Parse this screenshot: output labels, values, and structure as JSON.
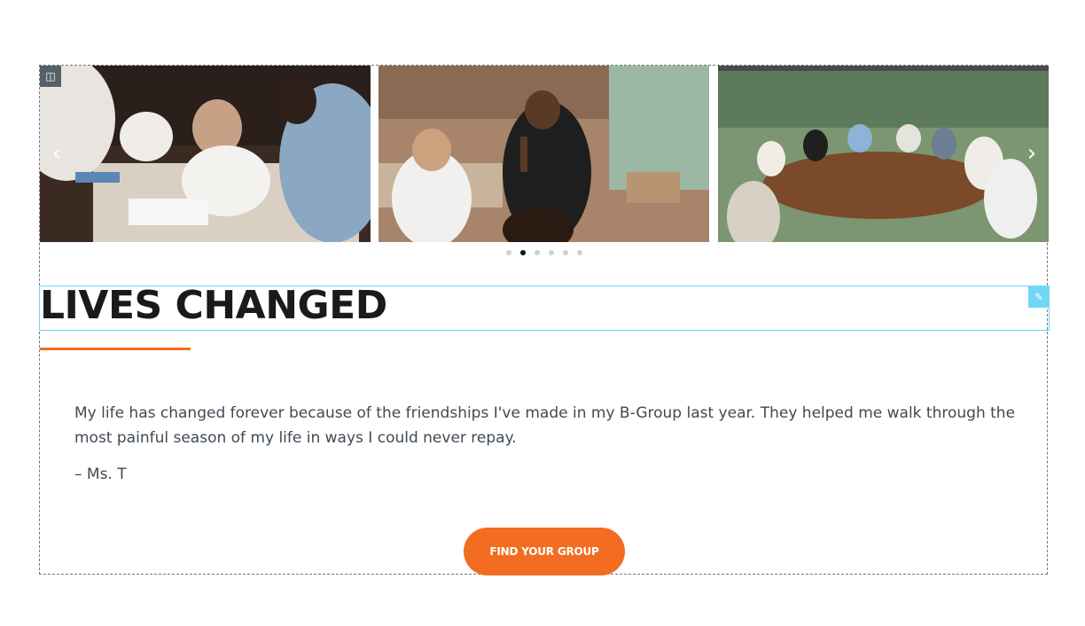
{
  "carousel": {
    "slides": [
      {
        "alt": "group of people talking around a restaurant table"
      },
      {
        "alt": "man in black sweatshirt raising his hand in a wooden room"
      },
      {
        "alt": "group meeting around a large round table near windows"
      }
    ],
    "prev_icon": "chevron-left-icon",
    "next_icon": "chevron-right-icon",
    "dot_count": 6,
    "active_dot": 1
  },
  "heading": {
    "text": "LIVES CHANGED"
  },
  "colors": {
    "accent": "#f26d21",
    "editor_highlight": "#71d7f7",
    "heading": "#1a1a1a",
    "body_text": "#3f4a54"
  },
  "testimonial": {
    "quote": "My life has changed forever because of the friendships I've made in my B-Group last year. They helped me walk through the most painful season of my life in ways I could never repay.",
    "author": "– Ms. T"
  },
  "cta": {
    "label": "FIND YOUR GROUP"
  }
}
